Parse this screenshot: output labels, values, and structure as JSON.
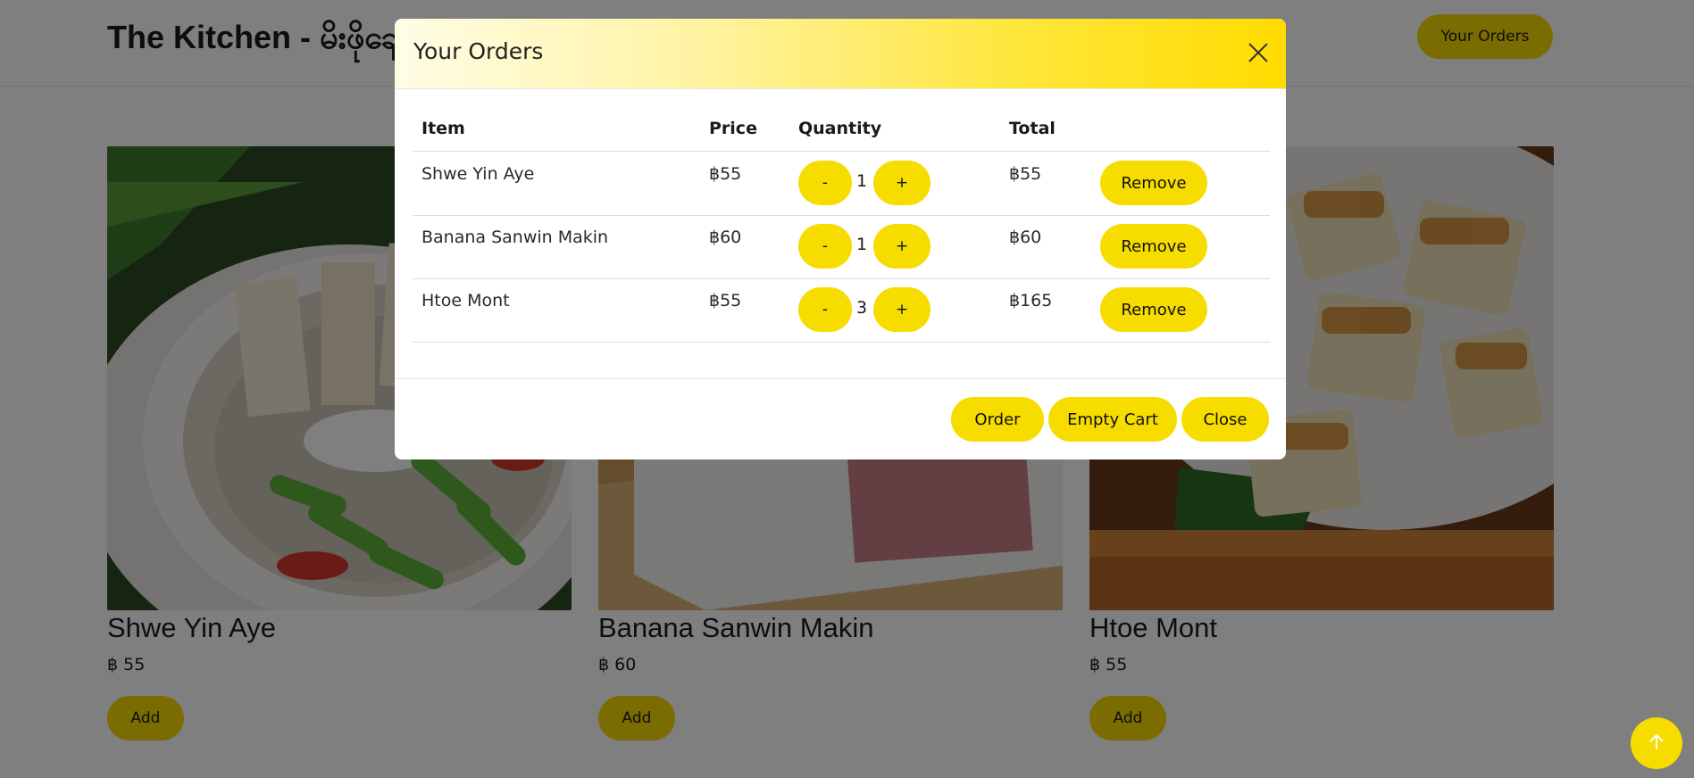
{
  "navbar": {
    "brand": "The Kitchen - မိးဖိုချောင်",
    "orders_button": "Your Orders"
  },
  "menu": {
    "items": [
      {
        "name": "Shwe Yin Aye",
        "price": "฿ 55",
        "add_label": "Add"
      },
      {
        "name": "Banana Sanwin Makin",
        "price": "฿ 60",
        "add_label": "Add"
      },
      {
        "name": "Htoe Mont",
        "price": "฿ 55",
        "add_label": "Add"
      }
    ]
  },
  "modal": {
    "title": "Your Orders",
    "columns": {
      "item": "Item",
      "price": "Price",
      "quantity": "Quantity",
      "total": "Total"
    },
    "rows": [
      {
        "item": "Shwe Yin Aye",
        "price": "฿55",
        "quantity": "1",
        "total": "฿55"
      },
      {
        "item": "Banana Sanwin Makin",
        "price": "฿60",
        "quantity": "1",
        "total": "฿60"
      },
      {
        "item": "Htoe Mont",
        "price": "฿55",
        "quantity": "3",
        "total": "฿165"
      }
    ],
    "minus_label": "-",
    "plus_label": "+",
    "remove_label": "Remove",
    "footer": {
      "order": "Order",
      "empty_cart": "Empty Cart",
      "close": "Close"
    }
  },
  "colors": {
    "accent": "#f7dc00",
    "backdrop": "rgba(0,0,0,0.5)"
  },
  "icons": {
    "close": "close-icon",
    "scroll_top": "arrow-up-icon"
  }
}
